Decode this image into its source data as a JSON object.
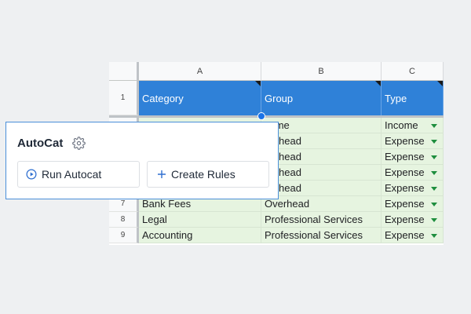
{
  "sheet": {
    "columns": [
      "A",
      "B",
      "C"
    ],
    "header_row_number": "1",
    "headers": [
      "Category",
      "Group",
      "Type"
    ],
    "rows": [
      {
        "num": "",
        "category": "",
        "group": "come",
        "type": "Income"
      },
      {
        "num": "",
        "category": "",
        "group": "verhead",
        "type": "Expense"
      },
      {
        "num": "",
        "category": "",
        "group": "verhead",
        "type": "Expense"
      },
      {
        "num": "",
        "category": "",
        "group": "verhead",
        "type": "Expense"
      },
      {
        "num": "",
        "category": "",
        "group": "verhead",
        "type": "Expense"
      },
      {
        "num": "7",
        "category": "Bank Fees",
        "group": "Overhead",
        "type": "Expense"
      },
      {
        "num": "8",
        "category": "Legal",
        "group": "Professional Services",
        "type": "Expense"
      },
      {
        "num": "9",
        "category": "Accounting",
        "group": "Professional Services",
        "type": "Expense"
      }
    ],
    "colors": {
      "header_bg": "#2f81d8",
      "data_bg": "#e6f4e0",
      "dropdown": "#1e8e3e"
    }
  },
  "panel": {
    "title": "AutoCat",
    "settings_icon": "gear-icon",
    "run_label": "Run Autocat",
    "run_icon": "play-circle-icon",
    "create_label": "Create Rules",
    "create_icon": "plus-icon",
    "accent": "#4a8fd9"
  }
}
